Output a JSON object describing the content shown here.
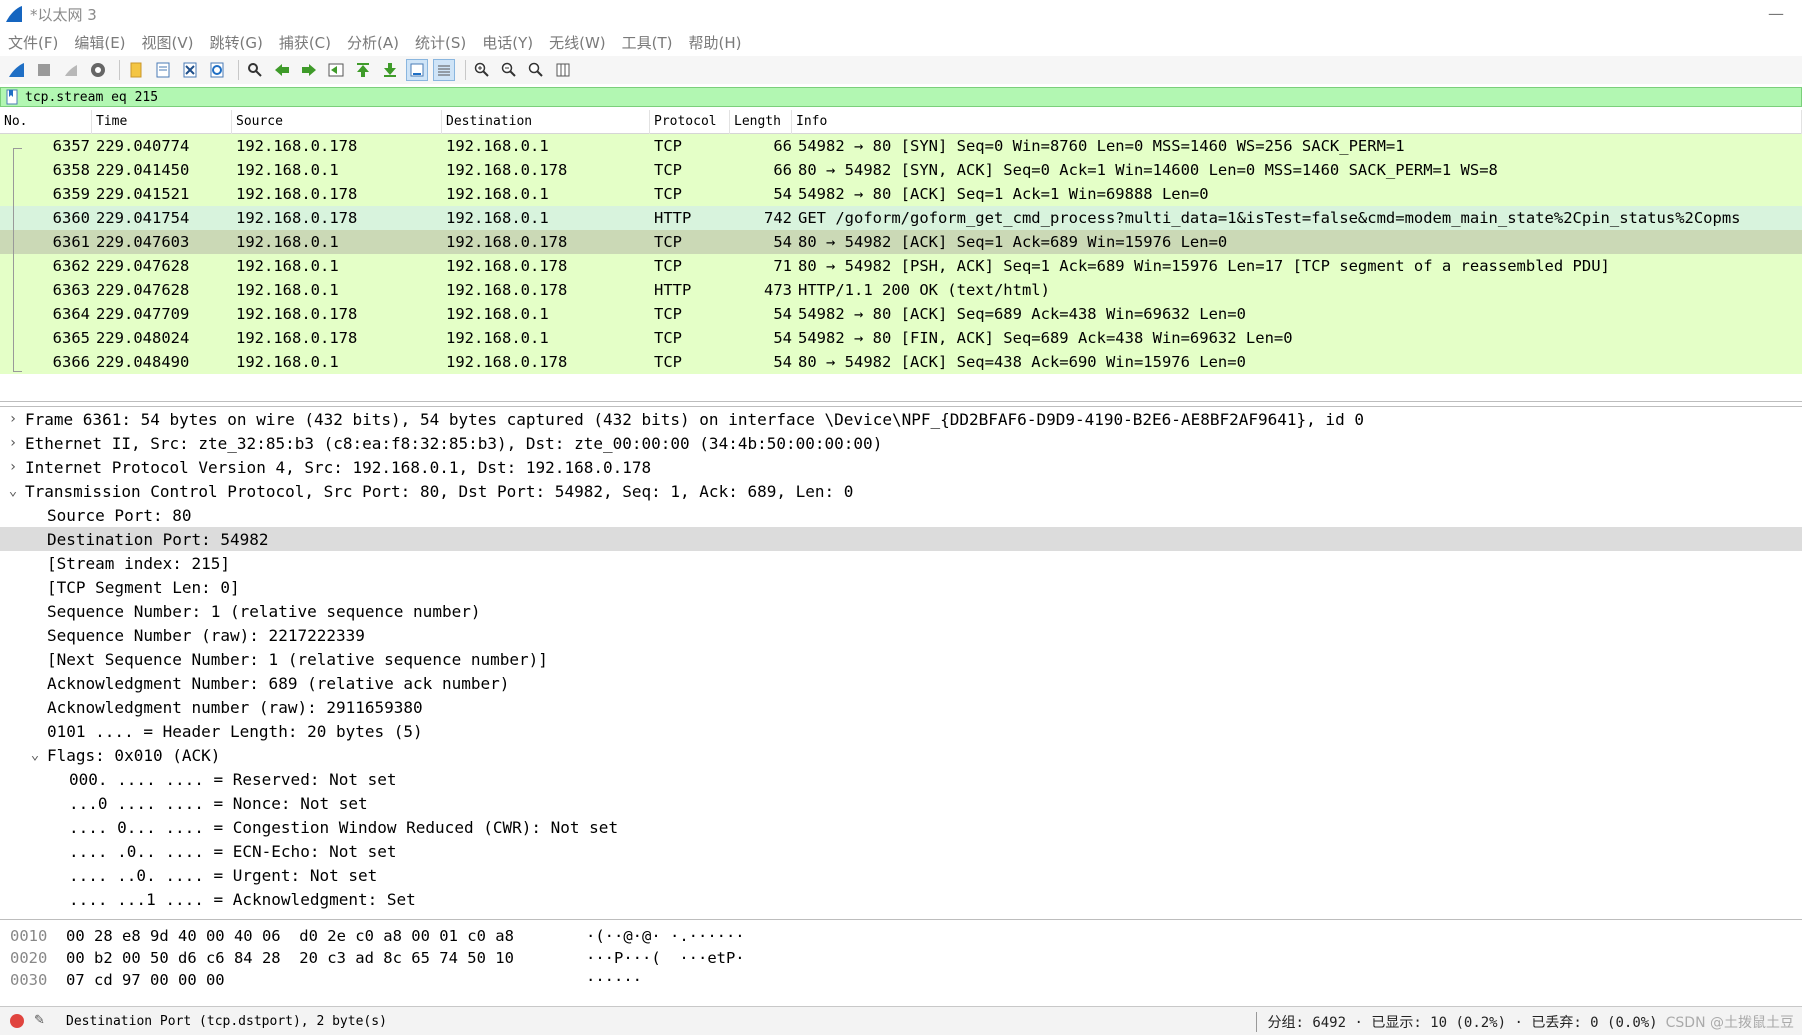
{
  "window": {
    "title": "*以太网 3",
    "minimize_glyph": "—"
  },
  "menu": [
    "文件(F)",
    "编辑(E)",
    "视图(V)",
    "跳转(G)",
    "捕获(C)",
    "分析(A)",
    "统计(S)",
    "电话(Y)",
    "无线(W)",
    "工具(T)",
    "帮助(H)"
  ],
  "filter": {
    "text": "tcp.stream eq 215",
    "background": "#b2f7b2"
  },
  "packet_list": {
    "columns": [
      "No.",
      "Time",
      "Source",
      "Destination",
      "Protocol",
      "Length",
      "Info"
    ],
    "rows": [
      {
        "no": "6357",
        "time": "229.040774",
        "src": "192.168.0.178",
        "dst": "192.168.0.1",
        "proto": "TCP",
        "len": "66",
        "info": "54982 → 80 [SYN] Seq=0 Win=8760 Len=0 MSS=1460 WS=256 SACK_PERM=1",
        "bg": "#e4ffc7"
      },
      {
        "no": "6358",
        "time": "229.041450",
        "src": "192.168.0.1",
        "dst": "192.168.0.178",
        "proto": "TCP",
        "len": "66",
        "info": "80 → 54982 [SYN, ACK] Seq=0 Ack=1 Win=14600 Len=0 MSS=1460 SACK_PERM=1 WS=8",
        "bg": "#e4ffc7"
      },
      {
        "no": "6359",
        "time": "229.041521",
        "src": "192.168.0.178",
        "dst": "192.168.0.1",
        "proto": "TCP",
        "len": "54",
        "info": "54982 → 80 [ACK] Seq=1 Ack=1 Win=69888 Len=0",
        "bg": "#e4ffc7"
      },
      {
        "no": "6360",
        "time": "229.041754",
        "src": "192.168.0.178",
        "dst": "192.168.0.1",
        "proto": "HTTP",
        "len": "742",
        "info": "GET /goform/goform_get_cmd_process?multi_data=1&isTest=false&cmd=modem_main_state%2Cpin_status%2Copms",
        "bg": "#d8f3dd"
      },
      {
        "no": "6361",
        "time": "229.047603",
        "src": "192.168.0.1",
        "dst": "192.168.0.178",
        "proto": "TCP",
        "len": "54",
        "info": "80 → 54982 [ACK] Seq=1 Ack=689 Win=15976 Len=0",
        "bg": "#cbd9b6"
      },
      {
        "no": "6362",
        "time": "229.047628",
        "src": "192.168.0.1",
        "dst": "192.168.0.178",
        "proto": "TCP",
        "len": "71",
        "info": "80 → 54982 [PSH, ACK] Seq=1 Ack=689 Win=15976 Len=17 [TCP segment of a reassembled PDU]",
        "bg": "#e4ffc7"
      },
      {
        "no": "6363",
        "time": "229.047628",
        "src": "192.168.0.1",
        "dst": "192.168.0.178",
        "proto": "HTTP",
        "len": "473",
        "info": "HTTP/1.1 200 OK  (text/html)",
        "bg": "#e4ffc7"
      },
      {
        "no": "6364",
        "time": "229.047709",
        "src": "192.168.0.178",
        "dst": "192.168.0.1",
        "proto": "TCP",
        "len": "54",
        "info": "54982 → 80 [ACK] Seq=689 Ack=438 Win=69632 Len=0",
        "bg": "#e4ffc7"
      },
      {
        "no": "6365",
        "time": "229.048024",
        "src": "192.168.0.178",
        "dst": "192.168.0.1",
        "proto": "TCP",
        "len": "54",
        "info": "54982 → 80 [FIN, ACK] Seq=689 Ack=438 Win=69632 Len=0",
        "bg": "#e4ffc7"
      },
      {
        "no": "6366",
        "time": "229.048490",
        "src": "192.168.0.1",
        "dst": "192.168.0.178",
        "proto": "TCP",
        "len": "54",
        "info": "80 → 54982 [ACK] Seq=438 Ack=690 Win=15976 Len=0",
        "bg": "#e4ffc7"
      }
    ]
  },
  "details": [
    {
      "indent": 0,
      "arrow": "›",
      "text": "Frame 6361: 54 bytes on wire (432 bits), 54 bytes captured (432 bits) on interface \\Device\\NPF_{DD2BFAF6-D9D9-4190-B2E6-AE8BF2AF9641}, id 0"
    },
    {
      "indent": 0,
      "arrow": "›",
      "text": "Ethernet II, Src: zte_32:85:b3 (c8:ea:f8:32:85:b3), Dst: zte_00:00:00 (34:4b:50:00:00:00)"
    },
    {
      "indent": 0,
      "arrow": "›",
      "text": "Internet Protocol Version 4, Src: 192.168.0.1, Dst: 192.168.0.178"
    },
    {
      "indent": 0,
      "arrow": "⌄",
      "text": "Transmission Control Protocol, Src Port: 80, Dst Port: 54982, Seq: 1, Ack: 689, Len: 0"
    },
    {
      "indent": 1,
      "arrow": "",
      "text": "Source Port: 80"
    },
    {
      "indent": 1,
      "arrow": "",
      "text": "Destination Port: 54982",
      "selected": true
    },
    {
      "indent": 1,
      "arrow": "",
      "text": "[Stream index: 215]"
    },
    {
      "indent": 1,
      "arrow": "",
      "text": "[TCP Segment Len: 0]"
    },
    {
      "indent": 1,
      "arrow": "",
      "text": "Sequence Number: 1    (relative sequence number)"
    },
    {
      "indent": 1,
      "arrow": "",
      "text": "Sequence Number (raw): 2217222339"
    },
    {
      "indent": 1,
      "arrow": "",
      "text": "[Next Sequence Number: 1    (relative sequence number)]"
    },
    {
      "indent": 1,
      "arrow": "",
      "text": "Acknowledgment Number: 689    (relative ack number)"
    },
    {
      "indent": 1,
      "arrow": "",
      "text": "Acknowledgment number (raw): 2911659380"
    },
    {
      "indent": 1,
      "arrow": "",
      "text": "0101 .... = Header Length: 20 bytes (5)"
    },
    {
      "indent": 1,
      "arrow": "⌄",
      "text": "Flags: 0x010 (ACK)"
    },
    {
      "indent": 2,
      "arrow": "",
      "text": "000. .... .... = Reserved: Not set"
    },
    {
      "indent": 2,
      "arrow": "",
      "text": "...0 .... .... = Nonce: Not set"
    },
    {
      "indent": 2,
      "arrow": "",
      "text": ".... 0... .... = Congestion Window Reduced (CWR): Not set"
    },
    {
      "indent": 2,
      "arrow": "",
      "text": ".... .0.. .... = ECN-Echo: Not set"
    },
    {
      "indent": 2,
      "arrow": "",
      "text": ".... ..0. .... = Urgent: Not set"
    },
    {
      "indent": 2,
      "arrow": "",
      "text": ".... ...1 .... = Acknowledgment: Set"
    }
  ],
  "bytes": [
    {
      "offset": "0010",
      "hex": "00 28 e8 9d 40 00 40 06  d0 2e c0 a8 00 01 c0 a8",
      "ascii": "·(··@·@· ·.······"
    },
    {
      "offset": "0020",
      "hex": "00 b2 00 50 d6 c6 84 28  20 c3 ad 8c 65 74 50 10",
      "ascii": "···P···(  ···etP·"
    },
    {
      "offset": "0030",
      "hex": "07 cd 97 00 00 00",
      "ascii": "······"
    }
  ],
  "status": {
    "field_text": "Destination Port (tcp.dstport), 2 byte(s)",
    "stats": "分组: 6492 · 已显示: 10 (0.2%) · 已丢弃: 0 (0.0%)",
    "watermark": "CSDN @土拨鼠土豆"
  }
}
